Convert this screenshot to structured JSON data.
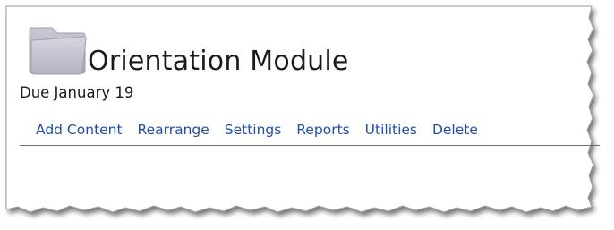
{
  "module": {
    "title": "Orientation Module",
    "due": "Due January 19",
    "icon": "folder-icon"
  },
  "actions": [
    {
      "label": "Add Content"
    },
    {
      "label": "Rearrange"
    },
    {
      "label": "Settings"
    },
    {
      "label": "Reports"
    },
    {
      "label": "Utilities"
    },
    {
      "label": "Delete"
    }
  ],
  "colors": {
    "link": "#1f4fa7",
    "folder": "#c7c7d2",
    "text": "#1a1a1a"
  }
}
